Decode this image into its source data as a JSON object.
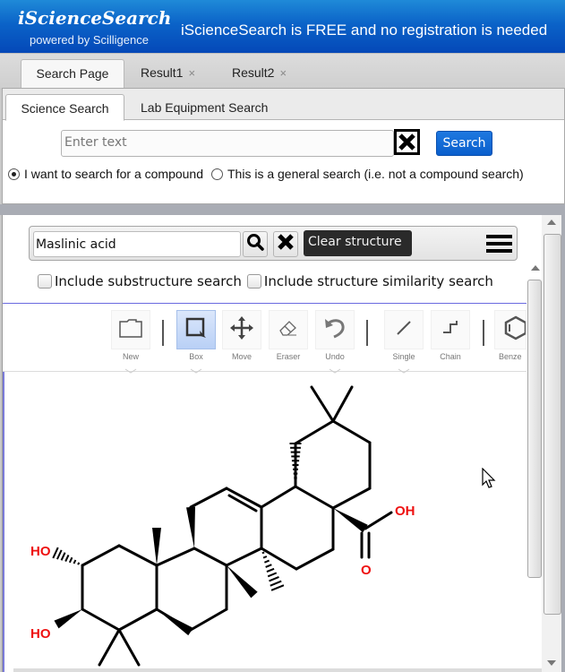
{
  "header": {
    "brand": "iScienceSearch",
    "brand_sub": "powered by Scilligence",
    "tagline": "iScienceSearch is FREE and no registration is needed"
  },
  "tabs": [
    {
      "label": "Search Page",
      "closable": false,
      "active": true
    },
    {
      "label": "Result1",
      "closable": true,
      "active": false
    },
    {
      "label": "Result2",
      "closable": true,
      "active": false
    }
  ],
  "tab_close_glyph": "×",
  "subtabs": [
    {
      "label": "Science Search",
      "active": true
    },
    {
      "label": "Lab Equipment Search",
      "active": false
    }
  ],
  "search": {
    "placeholder": "Enter text",
    "value": "",
    "clear_icon": "x-box-icon",
    "button_label": "Search"
  },
  "search_mode": {
    "options": [
      {
        "label": "I want to search for a compound",
        "selected": true
      },
      {
        "label": "This is a general search (i.e. not a compound search)",
        "selected": false
      }
    ]
  },
  "structure_bar": {
    "name_value": "Maslinic acid",
    "search_icon": "magnifier-icon",
    "clear_icon": "x-icon",
    "clear_button_label": "Clear structure",
    "menu_icon": "hamburger-icon"
  },
  "options": {
    "substructure_label": "Include substructure search",
    "substructure_checked": false,
    "similarity_label": "Include structure similarity search",
    "similarity_checked": false
  },
  "editor_toolbar": {
    "tools": [
      {
        "label": "New",
        "icon": "folder-icon",
        "has_menu": true,
        "active": false
      },
      {
        "label": "Box",
        "icon": "box-select-icon",
        "has_menu": true,
        "active": true
      },
      {
        "label": "Move",
        "icon": "move-icon",
        "has_menu": false,
        "active": false
      },
      {
        "label": "Eraser",
        "icon": "eraser-icon",
        "has_menu": false,
        "active": false
      },
      {
        "label": "Undo",
        "icon": "undo-icon",
        "has_menu": true,
        "active": false
      },
      {
        "label": "Single",
        "icon": "single-bond-icon",
        "has_menu": true,
        "active": false
      },
      {
        "label": "Chain",
        "icon": "chain-icon",
        "has_menu": false,
        "active": false
      },
      {
        "label": "Benze",
        "icon": "benzene-icon",
        "has_menu": false,
        "active": false
      }
    ]
  },
  "molecule": {
    "name": "Maslinic acid",
    "atom_labels": {
      "oh_top_left": "HO",
      "oh_bottom_left": "HO",
      "acid_oh": "OH",
      "acid_o": "O"
    },
    "heteroatom_color": "#ee1111"
  },
  "colors": {
    "header_blue": "#0b63c8",
    "search_button": "#0a5fcc",
    "clear_button": "#2a2a2a"
  }
}
